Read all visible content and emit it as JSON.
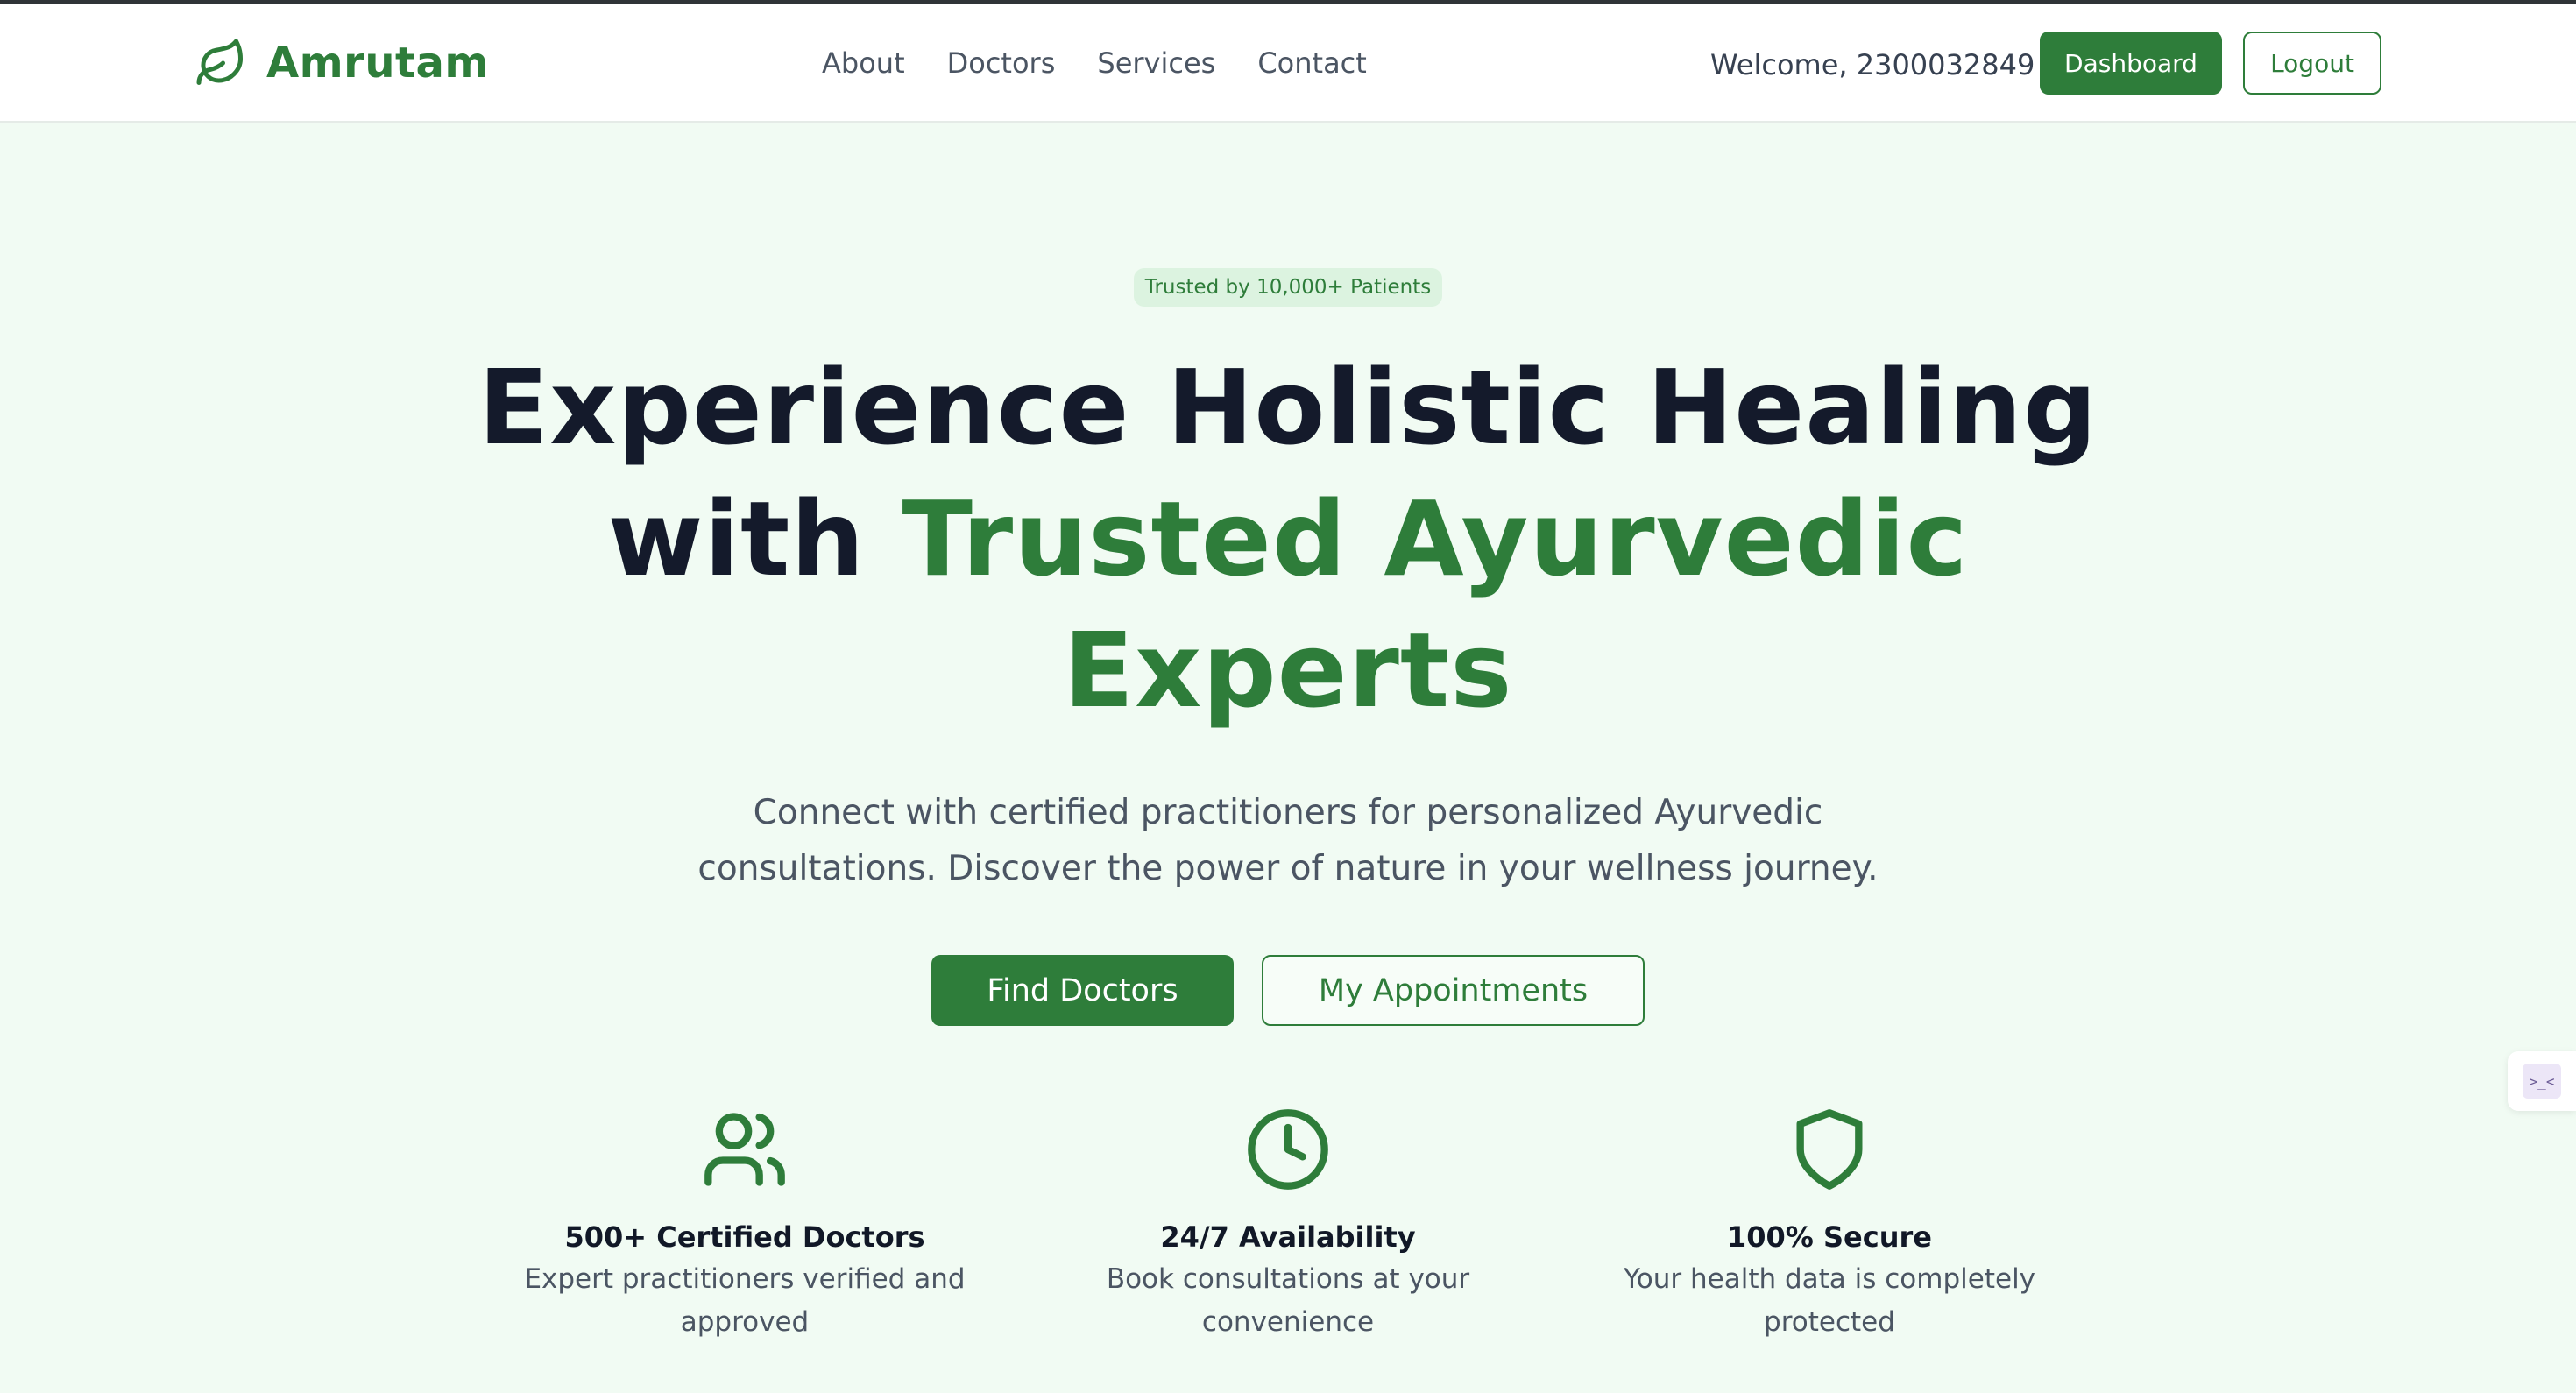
{
  "header": {
    "brand": "Amrutam",
    "nav": [
      "About",
      "Doctors",
      "Services",
      "Contact"
    ],
    "welcome": "Welcome, 2300032849",
    "dashboard_label": "Dashboard",
    "logout_label": "Logout"
  },
  "hero": {
    "badge": "Trusted by 10,000+ Patients",
    "title_line1": "Experience Holistic Healing",
    "title_with": "with",
    "title_green1": "Trusted Ayurvedic",
    "title_green2": "Experts",
    "subtitle": "Connect with certified practitioners for personalized Ayurvedic consultations. Discover the power of nature in your wellness journey.",
    "find_doctors_label": "Find Doctors",
    "my_appointments_label": "My Appointments"
  },
  "features": [
    {
      "icon": "users-icon",
      "title": "500+ Certified Doctors",
      "desc": "Expert practitioners verified and approved"
    },
    {
      "icon": "clock-icon",
      "title": "24/7 Availability",
      "desc": "Book consultations at your convenience"
    },
    {
      "icon": "shield-icon",
      "title": "100% Secure",
      "desc": "Your health data is completely protected"
    }
  ],
  "widget": {
    "icon": "code-icon",
    "glyph": ">_<"
  },
  "colors": {
    "brand_green": "#2e7d3a",
    "page_bg": "#f1fbf3",
    "heading_dark": "#141a2b"
  }
}
